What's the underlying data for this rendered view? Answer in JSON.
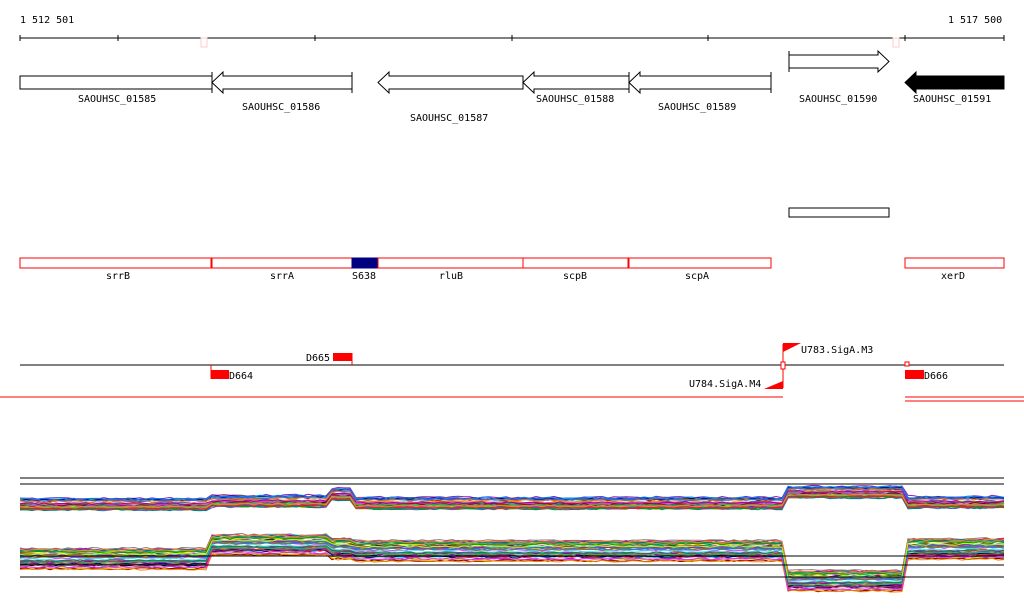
{
  "ruler": {
    "start_label": "1 512 501",
    "end_label": "1 517 500"
  },
  "genes": [
    {
      "id": "SAOUHSC_01585",
      "strand": "+",
      "from": 1512501,
      "to": 1513480
    },
    {
      "id": "SAOUHSC_01586",
      "strand": "-",
      "from": 1513480,
      "to": 1514190
    },
    {
      "id": "SAOUHSC_01587",
      "strand": "-",
      "from": 1514320,
      "to": 1515060
    },
    {
      "id": "SAOUHSC_01588",
      "strand": "-",
      "from": 1515060,
      "to": 1515600
    },
    {
      "id": "SAOUHSC_01589",
      "strand": "-",
      "from": 1515600,
      "to": 1516320
    },
    {
      "id": "SAOUHSC_01590",
      "strand": "+",
      "from": 1516410,
      "to": 1516920
    },
    {
      "id": "SAOUHSC_01591",
      "strand": "-",
      "from": 1517000,
      "to": 1517500
    }
  ],
  "operons": [
    {
      "name": "srrB"
    },
    {
      "name": "srrA"
    },
    {
      "name": "S638"
    },
    {
      "name": "rluB"
    },
    {
      "name": "scpB"
    },
    {
      "name": "scpA"
    },
    {
      "name": "xerD"
    }
  ],
  "features": {
    "d665": "D665",
    "d664": "D664",
    "d666": "D666",
    "u783": "U783.SigA.M3",
    "u784": "U784.SigA.M4"
  },
  "colors": {
    "operon": "#ff0000",
    "srna": "#000080",
    "feature": "#ff0000"
  }
}
